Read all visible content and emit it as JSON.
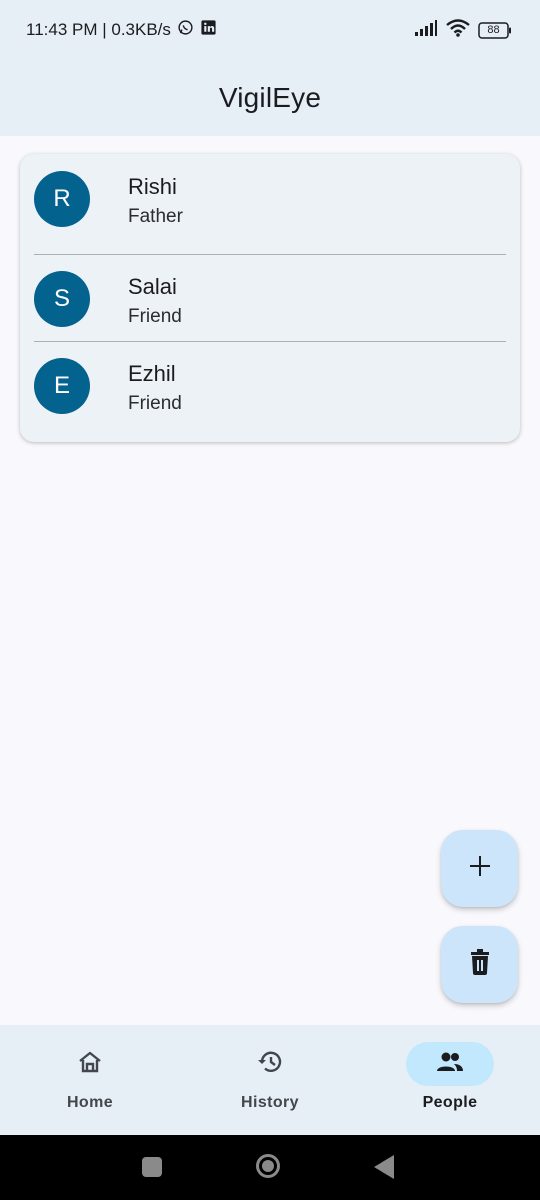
{
  "status_bar": {
    "time_text": "11:43 PM | 0.3KB/s",
    "battery": "88"
  },
  "app_bar": {
    "title": "VigilEye"
  },
  "people": [
    {
      "initial": "R",
      "name": "Rishi",
      "relation": "Father"
    },
    {
      "initial": "S",
      "name": "Salai",
      "relation": "Friend"
    },
    {
      "initial": "E",
      "name": "Ezhil",
      "relation": "Friend"
    }
  ],
  "fabs": {
    "add_icon": "plus-icon",
    "delete_icon": "trash-icon"
  },
  "bottom_nav": {
    "items": [
      {
        "label": "Home",
        "icon": "home-icon",
        "active": false
      },
      {
        "label": "History",
        "icon": "history-icon",
        "active": false
      },
      {
        "label": "People",
        "icon": "people-icon",
        "active": true
      }
    ]
  },
  "colors": {
    "accent": "#04628f",
    "surface_tint": "#e7eff6",
    "fab": "#cde5fb",
    "active_pill": "#c2e8fd"
  }
}
